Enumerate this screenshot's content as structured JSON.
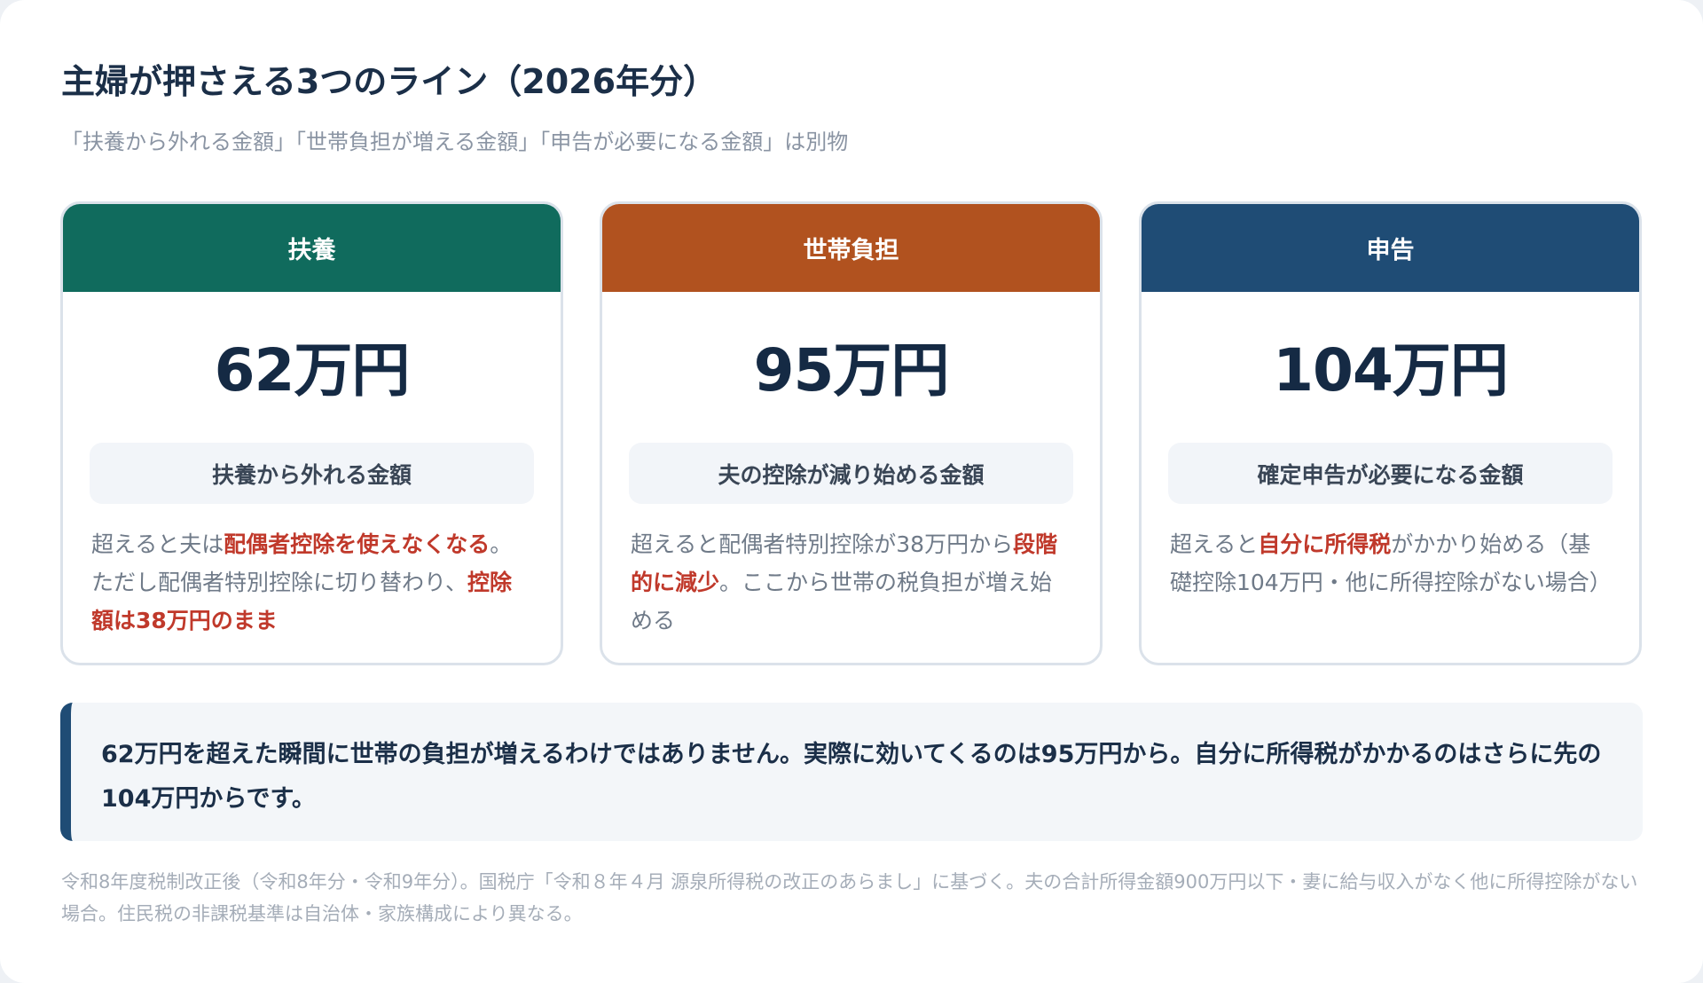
{
  "title": "主婦が押さえる3つのライン（2026年分）",
  "subtitle": "「扶養から外れる金額」「世帯負担が増える金額」「申告が必要になる金額」は別物",
  "colors": {
    "fuyou": "#106b5d",
    "setai": "#b1521f",
    "shinkoku": "#1f4c75",
    "emphasis": "#c0392b"
  },
  "cards": [
    {
      "header": "扶養",
      "amount": "62万円",
      "label": "扶養から外れる金額",
      "desc": [
        {
          "text": "超えると夫は"
        },
        {
          "text": "配偶者控除を使えなくなる",
          "emphasis": true
        },
        {
          "text": "。ただし配偶者特別控除に切り替わり、"
        },
        {
          "text": "控除額は38万円のまま",
          "emphasis": true
        }
      ]
    },
    {
      "header": "世帯負担",
      "amount": "95万円",
      "label": "夫の控除が減り始める金額",
      "desc": [
        {
          "text": "超えると配偶者特別控除が38万円から"
        },
        {
          "text": "段階的に減少",
          "emphasis": true
        },
        {
          "text": "。ここから世帯の税負担が増え始める"
        }
      ]
    },
    {
      "header": "申告",
      "amount": "104万円",
      "label": "確定申告が必要になる金額",
      "desc": [
        {
          "text": "超えると"
        },
        {
          "text": "自分に所得税",
          "emphasis": true
        },
        {
          "text": "がかかり始める（基礎控除104万円・他に所得控除がない場合）"
        }
      ]
    }
  ],
  "callout": "62万円を超えた瞬間に世帯の負担が増えるわけではありません。実際に効いてくるのは95万円から。自分に所得税がかかるのはさらに先の104万円からです。",
  "note": "令和8年度税制改正後（令和8年分・令和9年分）。国税庁「令和８年４月 源泉所得税の改正のあらまし」に基づく。夫の合計所得金額900万円以下・妻に給与収入がなく他に所得控除がない場合。住民税の非課税基準は自治体・家族構成により異なる。"
}
